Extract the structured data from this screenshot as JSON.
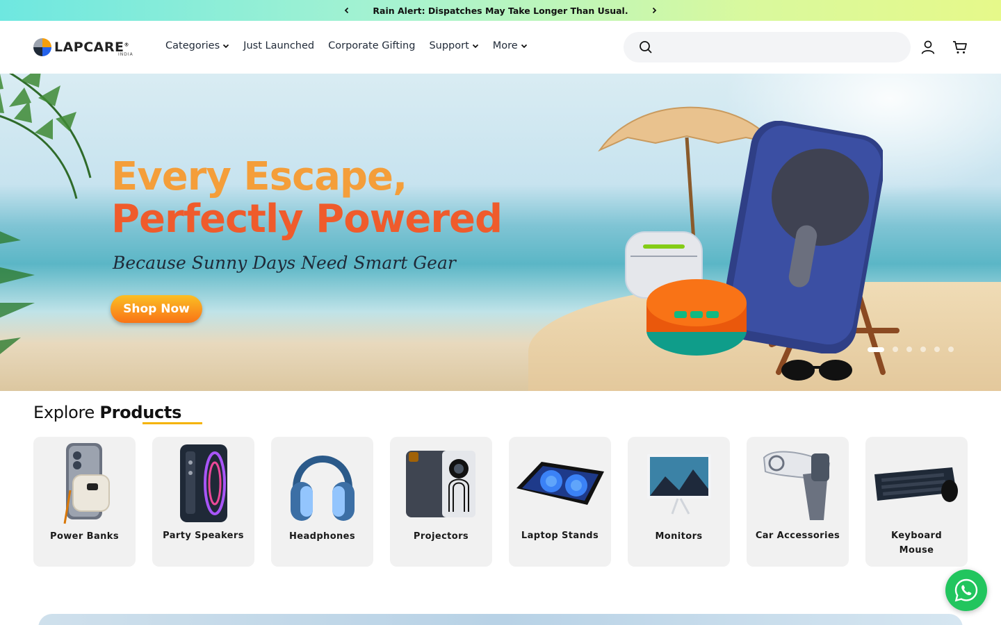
{
  "announcement": {
    "message": "Rain Alert: Dispatches May Take Longer Than Usual.",
    "prev_icon": "chevron-left-icon",
    "next_icon": "chevron-right-icon"
  },
  "header": {
    "logo_text": "LAPCARE",
    "logo_reg": "®",
    "logo_sub": "INDIA",
    "nav": [
      {
        "label": "Categories",
        "has_dropdown": true
      },
      {
        "label": "Just Launched",
        "has_dropdown": false
      },
      {
        "label": "Corporate Gifting",
        "has_dropdown": false
      },
      {
        "label": "Support",
        "has_dropdown": true
      },
      {
        "label": "More",
        "has_dropdown": true
      }
    ],
    "search_placeholder": "",
    "account_icon": "user-icon",
    "cart_icon": "cart-icon"
  },
  "hero": {
    "headline_line1": "Every Escape,",
    "headline_line2": "Perfectly Powered",
    "subheadline": "Because Sunny Days Need Smart Gear",
    "cta_label": "Shop Now",
    "slide_count": 6,
    "active_slide": 1
  },
  "explore": {
    "title_light": "Explore",
    "title_bold": "Products",
    "accent": "#f5b301",
    "categories": [
      {
        "label": "Power Banks"
      },
      {
        "label": "Party Speakers"
      },
      {
        "label": "Headphones"
      },
      {
        "label": "Projectors"
      },
      {
        "label": "Laptop Stands"
      },
      {
        "label": "Monitors"
      },
      {
        "label": "Car Accessories"
      },
      {
        "label": "Keyboard Mouse"
      }
    ]
  },
  "floating": {
    "whatsapp_icon": "whatsapp-icon"
  },
  "colors": {
    "headline_orange": "#ef5b2c",
    "cta_gradient_top": "#fbbf24",
    "cta_gradient_bottom": "#f97316",
    "whatsapp_green": "#22c55e"
  }
}
